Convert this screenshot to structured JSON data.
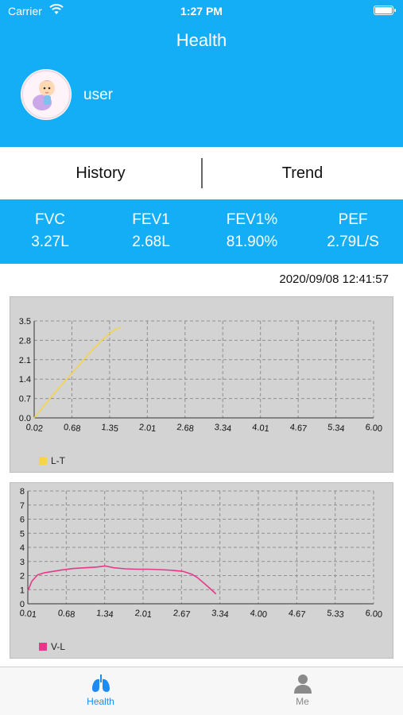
{
  "status_bar": {
    "carrier": "Carrier",
    "time": "1:27 PM"
  },
  "header": {
    "title": "Health",
    "username": "user"
  },
  "tabs": [
    {
      "label": "History"
    },
    {
      "label": "Trend"
    }
  ],
  "metrics": [
    {
      "label": "FVC",
      "value": "3.27L"
    },
    {
      "label": "FEV1",
      "value": "2.68L"
    },
    {
      "label": "FEV1%",
      "value": "81.90%"
    },
    {
      "label": "PEF",
      "value": "2.79L/S"
    }
  ],
  "measurement_time": "2020/09/08 12:41:57",
  "colors": {
    "accent": "#14aef7",
    "lt_series": "#f5d44a",
    "vl_series": "#e8388a",
    "chart_bg": "#d3d3d3",
    "tab_active": "#1e8bf0",
    "tab_inactive": "#888888"
  },
  "chart_data": [
    {
      "type": "line",
      "x_tick_labels": [
        "0.02",
        "0.68",
        "1.35",
        "2.01",
        "2.68",
        "3.34",
        "4.01",
        "4.67",
        "5.34",
        "6.00"
      ],
      "y_tick_labels": [
        "0.0",
        "0.7",
        "1.4",
        "2.1",
        "2.8",
        "3.5"
      ],
      "xlim": [
        0.02,
        6.0
      ],
      "ylim": [
        0.0,
        3.5
      ],
      "grid": true,
      "legend_position": "bottom-left",
      "series": [
        {
          "name": "L-T",
          "color": "#f5d44a",
          "x": [
            0.02,
            0.2,
            0.4,
            0.6,
            0.8,
            1.0,
            1.2,
            1.35,
            1.45,
            1.55
          ],
          "y": [
            0.0,
            0.45,
            0.95,
            1.42,
            1.88,
            2.35,
            2.78,
            3.05,
            3.2,
            3.27
          ]
        }
      ]
    },
    {
      "type": "line",
      "x_tick_labels": [
        "0.01",
        "0.68",
        "1.34",
        "2.01",
        "2.67",
        "3.34",
        "4.00",
        "4.67",
        "5.33",
        "6.00"
      ],
      "y_tick_labels": [
        "0",
        "1",
        "2",
        "3",
        "4",
        "5",
        "6",
        "7",
        "8"
      ],
      "xlim": [
        0.01,
        6.0
      ],
      "ylim": [
        0,
        8
      ],
      "grid": true,
      "legend_position": "bottom-left",
      "series": [
        {
          "name": "V-L",
          "color": "#e8388a",
          "x": [
            0.01,
            0.08,
            0.18,
            0.3,
            0.45,
            0.6,
            0.8,
            1.0,
            1.2,
            1.35,
            1.5,
            1.7,
            1.9,
            2.1,
            2.3,
            2.5,
            2.7,
            2.85,
            2.95,
            3.05,
            3.15,
            3.27
          ],
          "y": [
            0.9,
            1.6,
            2.05,
            2.2,
            2.3,
            2.4,
            2.5,
            2.55,
            2.6,
            2.68,
            2.55,
            2.48,
            2.45,
            2.45,
            2.42,
            2.38,
            2.3,
            2.1,
            1.85,
            1.5,
            1.15,
            0.7
          ]
        }
      ]
    }
  ],
  "tabbar": [
    {
      "label": "Health",
      "icon": "lungs-icon"
    },
    {
      "label": "Me",
      "icon": "person-icon"
    }
  ]
}
